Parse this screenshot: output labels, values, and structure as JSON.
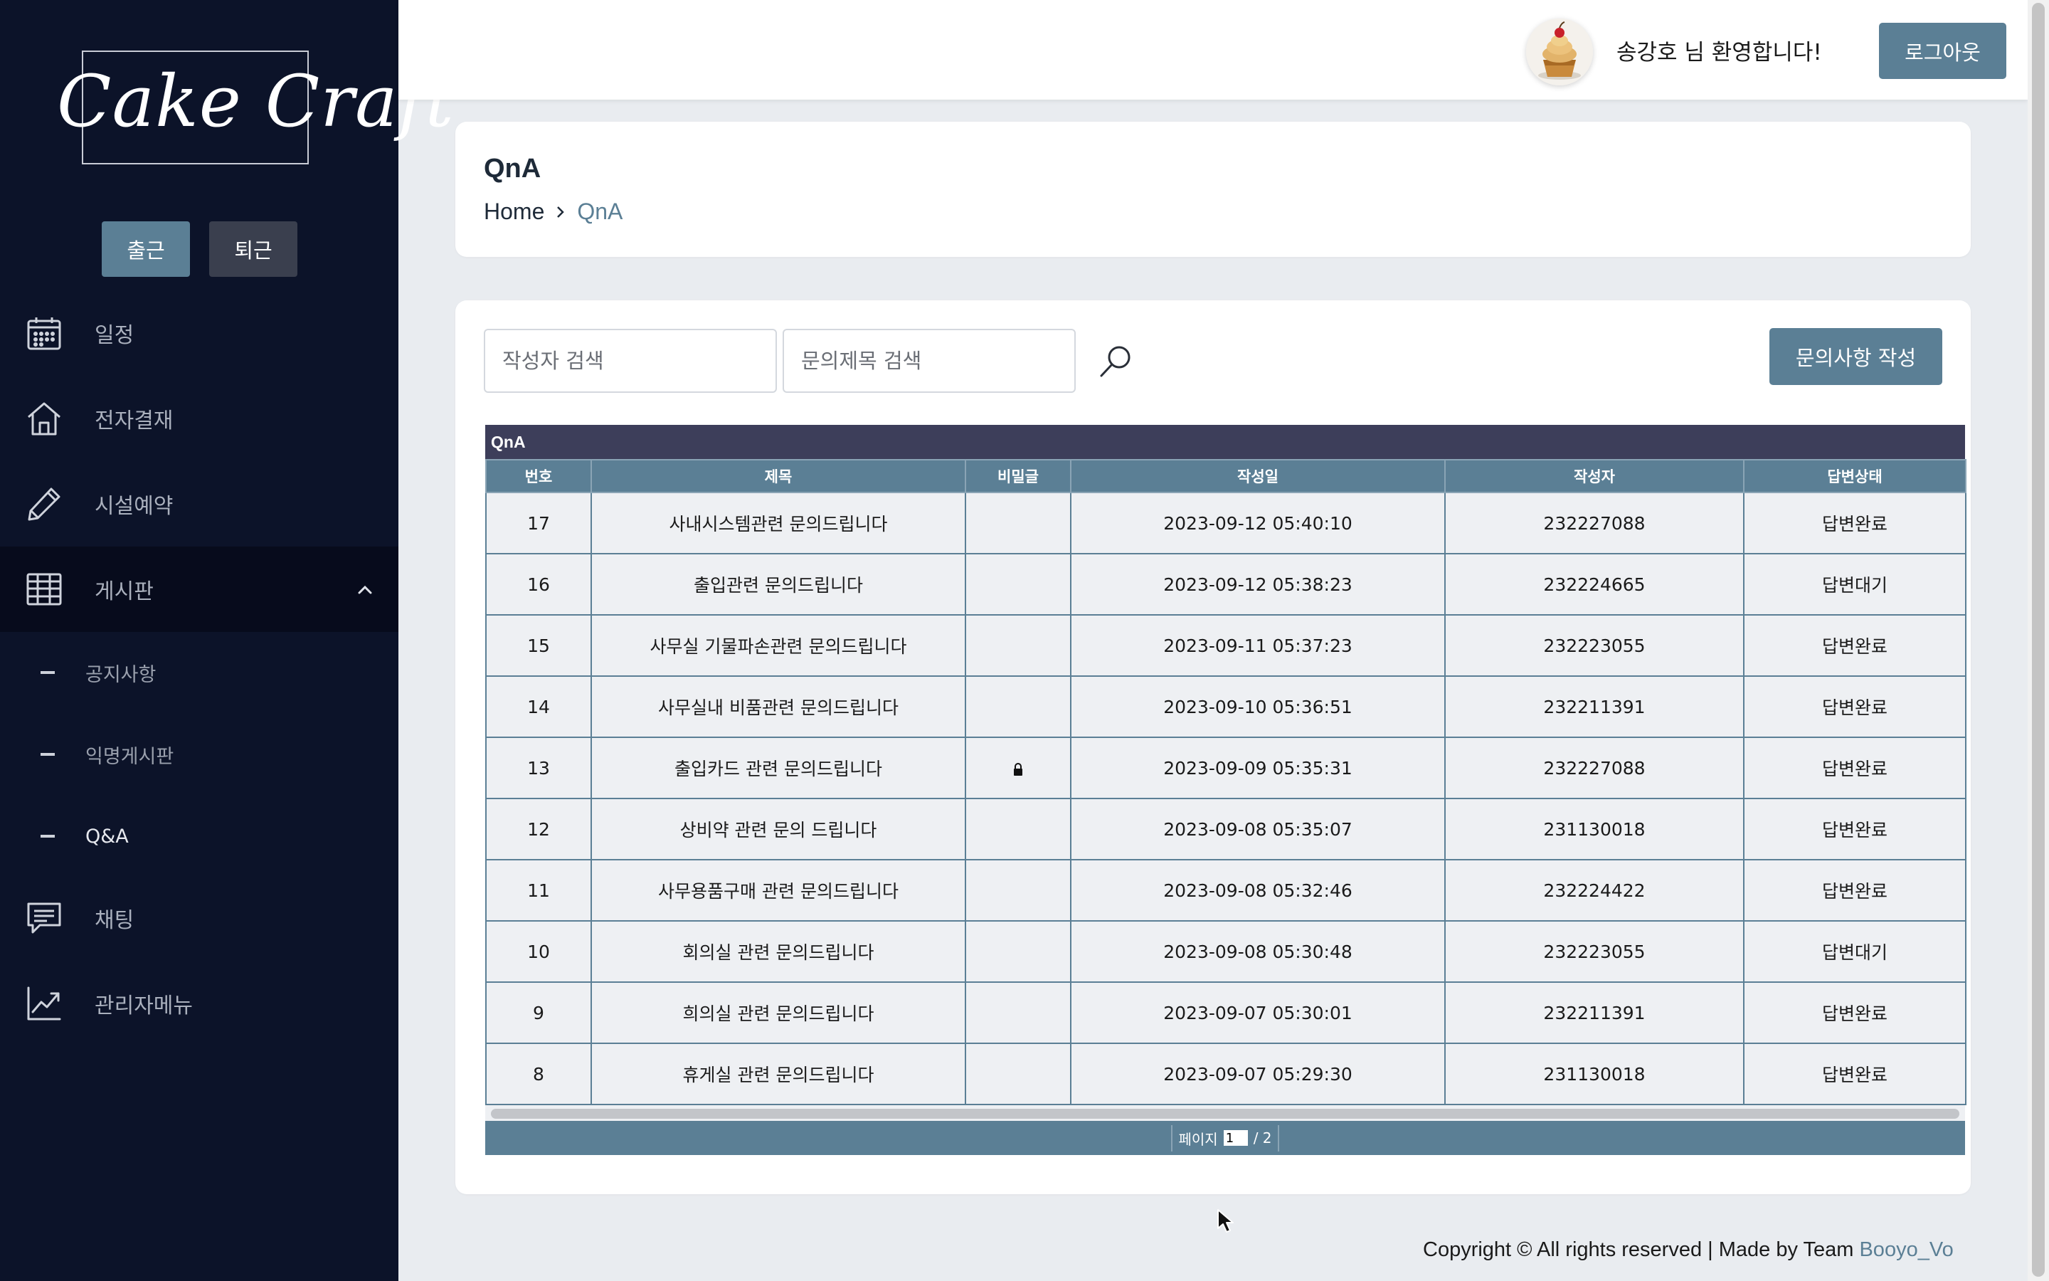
{
  "sidebar": {
    "logo": "Cake Craft",
    "attendance": {
      "check_in": "출근",
      "check_out": "퇴근"
    },
    "menu": [
      {
        "label": "일정",
        "icon": "calendar-icon"
      },
      {
        "label": "전자결재",
        "icon": "home-icon"
      },
      {
        "label": "시설예약",
        "icon": "pencil-icon"
      },
      {
        "label": "게시판",
        "icon": "table-grid-icon",
        "expanded": true
      },
      {
        "label": "채팅",
        "icon": "chat-icon"
      },
      {
        "label": "관리자메뉴",
        "icon": "chart-trend-icon"
      }
    ],
    "board_submenu": [
      {
        "label": "공지사항"
      },
      {
        "label": "익명게시판"
      },
      {
        "label": "Q&A",
        "current": true
      }
    ]
  },
  "header": {
    "welcome": "송강호 님 환영합니다!",
    "logout": "로그아웃"
  },
  "page": {
    "title": "QnA",
    "breadcrumb": {
      "home": "Home",
      "current": "QnA"
    }
  },
  "search": {
    "writer_placeholder": "작성자 검색",
    "title_placeholder": "문의제목 검색",
    "write_button": "문의사항 작성"
  },
  "grid": {
    "caption": "QnA",
    "columns": [
      "번호",
      "제목",
      "비밀글",
      "작성일",
      "작성자",
      "답변상태"
    ],
    "rows": [
      {
        "no": "17",
        "title": "사내시스템관련 문의드립니다",
        "secret": false,
        "date": "2023-09-12 05:40:10",
        "writer": "232227088",
        "status": "답변완료"
      },
      {
        "no": "16",
        "title": "출입관련 문의드립니다",
        "secret": false,
        "date": "2023-09-12 05:38:23",
        "writer": "232224665",
        "status": "답변대기"
      },
      {
        "no": "15",
        "title": "사무실 기물파손관련 문의드립니다",
        "secret": false,
        "date": "2023-09-11 05:37:23",
        "writer": "232223055",
        "status": "답변완료"
      },
      {
        "no": "14",
        "title": "사무실내 비품관련 문의드립니다",
        "secret": false,
        "date": "2023-09-10 05:36:51",
        "writer": "232211391",
        "status": "답변완료"
      },
      {
        "no": "13",
        "title": "출입카드 관련 문의드립니다",
        "secret": true,
        "date": "2023-09-09 05:35:31",
        "writer": "232227088",
        "status": "답변완료"
      },
      {
        "no": "12",
        "title": "상비약 관련 문의 드립니다",
        "secret": false,
        "date": "2023-09-08 05:35:07",
        "writer": "231130018",
        "status": "답변완료"
      },
      {
        "no": "11",
        "title": "사무용품구매 관련 문의드립니다",
        "secret": false,
        "date": "2023-09-08 05:32:46",
        "writer": "232224422",
        "status": "답변완료"
      },
      {
        "no": "10",
        "title": "회의실 관련 문의드립니다",
        "secret": false,
        "date": "2023-09-08 05:30:48",
        "writer": "232223055",
        "status": "답변대기"
      },
      {
        "no": "9",
        "title": "희의실 관련 문의드립니다",
        "secret": false,
        "date": "2023-09-07 05:30:01",
        "writer": "232211391",
        "status": "답변완료"
      },
      {
        "no": "8",
        "title": "휴게실 관련 문의드립니다",
        "secret": false,
        "date": "2023-09-07 05:29:30",
        "writer": "231130018",
        "status": "답변완료"
      }
    ],
    "pager": {
      "label": "페이지",
      "current": "1",
      "total": "/ 2"
    }
  },
  "footer": {
    "text": "Copyright © All rights reserved | Made by Team ",
    "team": "Booyo_Vo"
  },
  "colors": {
    "sidebar_bg": "#0c1329",
    "accent": "#5b7f95",
    "grid_caption": "#3d3e5a",
    "page_bg": "#e9ecf0"
  }
}
